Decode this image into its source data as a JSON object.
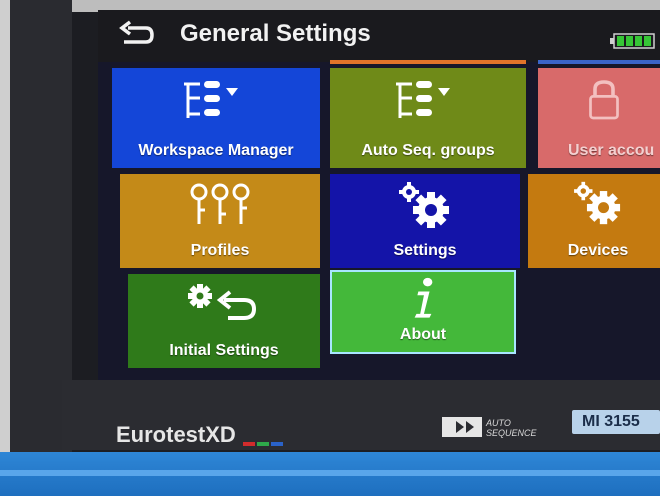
{
  "header": {
    "title": "General Settings",
    "back_icon": "back-arrow-icon",
    "battery_icon": "battery-icon"
  },
  "tiles": [
    {
      "label": "Workspace Manager",
      "icon": "tree-list-icon",
      "color": "#1446d8"
    },
    {
      "label": "Auto Seq. groups",
      "icon": "tree-list-icon",
      "color": "#6f8a18"
    },
    {
      "label": "User accou",
      "icon": "lock-icon",
      "color": "#d86a6a"
    },
    {
      "label": "Profiles",
      "icon": "profiles-icon",
      "color": "#c48a18"
    },
    {
      "label": "Settings",
      "icon": "gears-icon",
      "color": "#1414a8"
    },
    {
      "label": "Devices",
      "icon": "gears-icon",
      "color": "#c47a10"
    },
    {
      "label": "Initial Settings",
      "icon": "gear-return-icon",
      "color": "#2f7a1a"
    },
    {
      "label": "About",
      "icon": "info-icon",
      "color": "#44b83a"
    }
  ],
  "device": {
    "brand": "EurotestXD",
    "autoseq_line1": "AUTO",
    "autoseq_line2": "SEQUENCE",
    "model": "MI 3155"
  }
}
